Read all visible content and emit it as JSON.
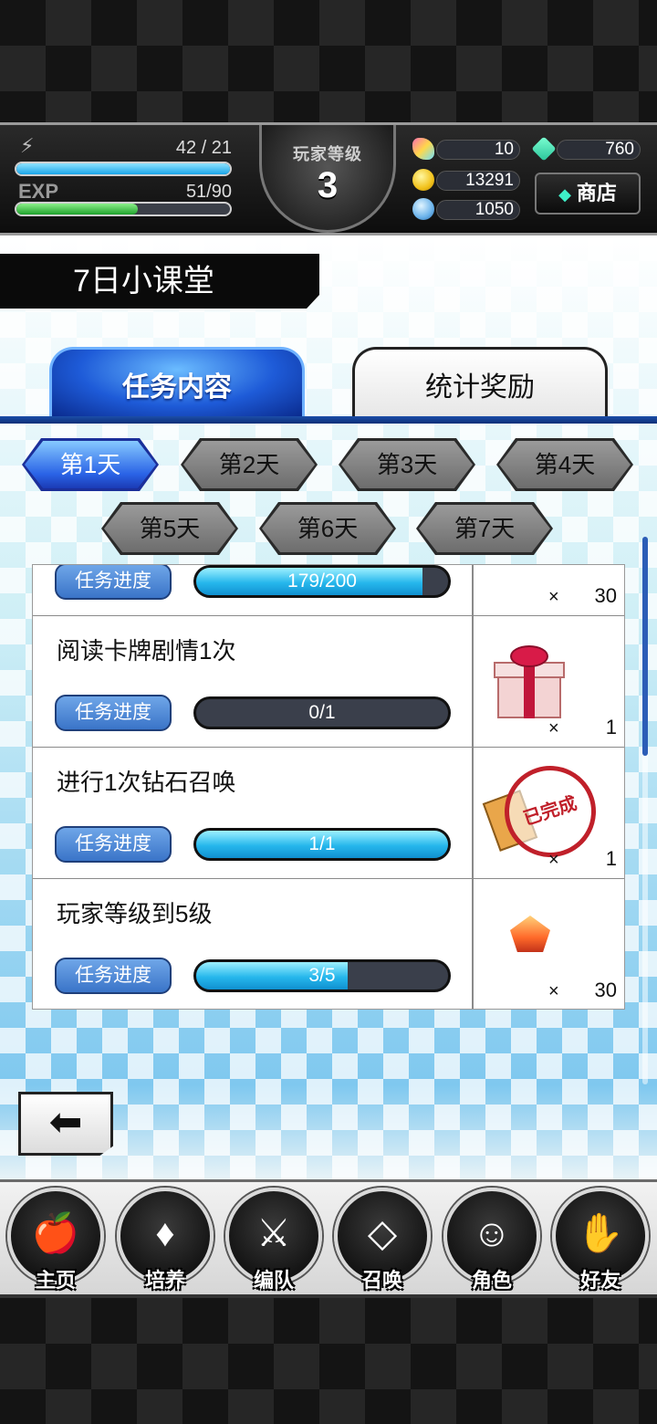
{
  "status": {
    "stamina": "42 / 21",
    "stamina_fill": 1.0,
    "exp_label": "EXP",
    "exp": "51/90",
    "exp_fill": 0.5667,
    "level_title": "玩家等级",
    "level": "3",
    "feather": "10",
    "gold": "13291",
    "orb": "1050",
    "diamond": "760",
    "shop_label": "商店"
  },
  "page_title": "7日小课堂",
  "tabs": {
    "tasks": "任务内容",
    "stats": "统计奖励"
  },
  "days": [
    "第1天",
    "第2天",
    "第3天",
    "第4天",
    "第5天",
    "第6天",
    "第7天"
  ],
  "progress_label": "任务进度",
  "tasks": [
    {
      "name": "",
      "progress": "179/200",
      "fill": 0.895,
      "reward_qty": "30",
      "reward_icon": "gem-icon"
    },
    {
      "name": "阅读卡牌剧情1次",
      "progress": "0/1",
      "fill": 0,
      "reward_qty": "1",
      "reward_icon": "gift-box-icon"
    },
    {
      "name": "进行1次钻石召唤",
      "progress": "1/1",
      "fill": 1,
      "reward_qty": "1",
      "reward_icon": "summon-ticket-icon",
      "claimed_stamp": "已完成"
    },
    {
      "name": "玩家等级到5级",
      "progress": "3/5",
      "fill": 0.6,
      "reward_qty": "30",
      "reward_icon": "fire-crystal-icon"
    }
  ],
  "times": "×",
  "nav": [
    "主页",
    "培养",
    "编队",
    "召唤",
    "角色",
    "好友"
  ],
  "colors": {
    "accent": "#1e5bd8",
    "progress": "#26b7ec"
  }
}
